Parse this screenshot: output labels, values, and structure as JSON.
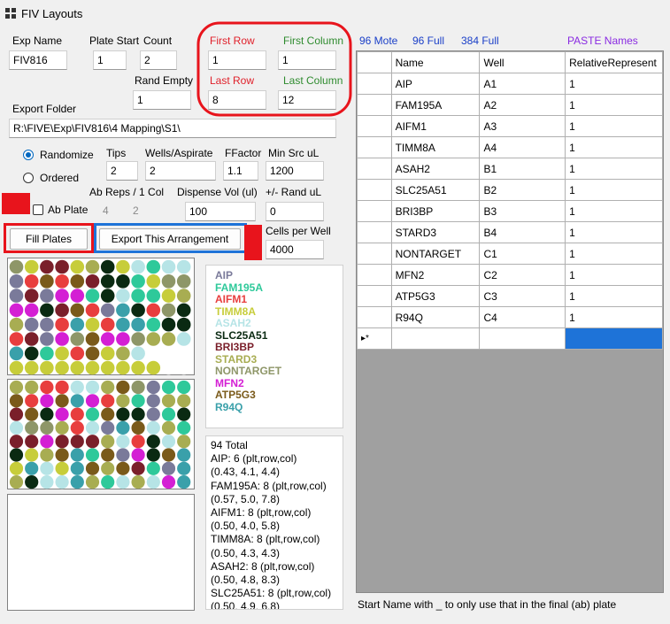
{
  "window": {
    "title": "FIV Layouts"
  },
  "form": {
    "exp_name": {
      "label": "Exp Name",
      "value": "FIV816"
    },
    "plate_start": {
      "label": "Plate Start",
      "value": "1"
    },
    "count": {
      "label": "Count",
      "value": "2"
    },
    "rand_empty": {
      "label": "Rand Empty",
      "value": "1"
    },
    "first_row": {
      "label": "First Row",
      "value": "1"
    },
    "first_column": {
      "label": "First Column",
      "value": "1"
    },
    "last_row": {
      "label": "Last Row",
      "value": "8"
    },
    "last_column": {
      "label": "Last Column",
      "value": "12"
    },
    "export_folder": {
      "label": "Export Folder",
      "value": "R:\\FIVE\\Exp\\FIV816\\4 Mapping\\S1\\"
    },
    "randomize_label": "Randomize",
    "ordered_label": "Ordered",
    "tips": {
      "label": "Tips",
      "value": "2"
    },
    "wells_aspirate": {
      "label": "Wells/Aspirate",
      "value": "2"
    },
    "ffactor": {
      "label": "FFactor",
      "value": "1.1"
    },
    "min_src_ul": {
      "label": "Min Src uL",
      "value": "1200"
    },
    "ab_reps_label": "Ab Reps / 1 Col",
    "ab_reps_a": "4",
    "ab_reps_b": "2",
    "dispense_vol": {
      "label": "Dispense Vol (ul)",
      "value": "100"
    },
    "rand_ul": {
      "label": "+/- Rand uL",
      "value": "0"
    },
    "ab_plate_label": "Ab Plate",
    "cells_per_well": {
      "label": "Cells per Well",
      "value": "4000"
    },
    "fill_plates_label": "Fill Plates",
    "export_label": "Export This Arrangement"
  },
  "links": {
    "mote96": "96 Mote",
    "full96": "96 Full",
    "full384": "384 Full",
    "paste_names": "PASTE Names"
  },
  "colors": {
    "accent_red": "#e8141c",
    "accent_blue": "#1e73d8",
    "link_blue": "#1a3fc8",
    "paste_purple": "#8a2be2",
    "first_row_red": "#e0202a",
    "first_col_green": "#2e8b2e"
  },
  "legend": [
    {
      "name": "AIP",
      "color": "#7a7a9a"
    },
    {
      "name": "FAM195A",
      "color": "#2ec99a"
    },
    {
      "name": "AIFM1",
      "color": "#e83e3e"
    },
    {
      "name": "TIMM8A",
      "color": "#c7cd3a"
    },
    {
      "name": "ASAH2",
      "color": "#b6e4e6"
    },
    {
      "name": "SLC25A51",
      "color": "#0a2a12"
    },
    {
      "name": "BRI3BP",
      "color": "#7a1f2a"
    },
    {
      "name": "STARD3",
      "color": "#a8ad52"
    },
    {
      "name": "NONTARGET",
      "color": "#8e9668"
    },
    {
      "name": "MFN2",
      "color": "#d41fd4"
    },
    {
      "name": "ATP5G3",
      "color": "#7a5a1a"
    },
    {
      "name": "R94Q",
      "color": "#3aa0aa"
    }
  ],
  "plate1": [
    [
      "NONTARGET",
      "TIMM8A",
      "BRI3BP",
      "BRI3BP",
      "TIMM8A",
      "STARD3",
      "SLC25A51",
      "TIMM8A",
      "ASAH2",
      "FAM195A",
      "ASAH2",
      "ASAH2"
    ],
    [
      "AIP",
      "AIFM1",
      "ATP5G3",
      "AIFM1",
      "ATP5G3",
      "BRI3BP",
      "SLC25A51",
      "SLC25A51",
      "FAM195A",
      "TIMM8A",
      "NONTARGET",
      "NONTARGET"
    ],
    [
      "AIP",
      "BRI3BP",
      "AIP",
      "MFN2",
      "MFN2",
      "FAM195A",
      "SLC25A51",
      "ASAH2",
      "FAM195A",
      "FAM195A",
      "TIMM8A",
      "STARD3"
    ],
    [
      "MFN2",
      "MFN2",
      "SLC25A51",
      "BRI3BP",
      "ATP5G3",
      "AIFM1",
      "AIP",
      "R94Q",
      "SLC25A51",
      "AIFM1",
      "NONTARGET",
      "SLC25A51"
    ],
    [
      "STARD3",
      "AIP",
      "AIP",
      "AIFM1",
      "R94Q",
      "TIMM8A",
      "AIFM1",
      "R94Q",
      "R94Q",
      "FAM195A",
      "SLC25A51",
      "SLC25A51"
    ],
    [
      "AIFM1",
      "BRI3BP",
      "AIP",
      "MFN2",
      "NONTARGET",
      "ATP5G3",
      "MFN2",
      "MFN2",
      "NONTARGET",
      "STARD3",
      "STARD3",
      "ASAH2"
    ],
    [
      "R94Q",
      "SLC25A51",
      "FAM195A",
      "TIMM8A",
      "AIFM1",
      "ATP5G3",
      "TIMM8A",
      "STARD3",
      "ASAH2",
      "",
      "",
      ""
    ],
    [
      "TIMM8A",
      "TIMM8A",
      "TIMM8A",
      "TIMM8A",
      "TIMM8A",
      "TIMM8A",
      "TIMM8A",
      "TIMM8A",
      "TIMM8A",
      "TIMM8A",
      "",
      ""
    ]
  ],
  "plate2": [
    [
      "STARD3",
      "STARD3",
      "AIFM1",
      "AIFM1",
      "ASAH2",
      "ASAH2",
      "STARD3",
      "ATP5G3",
      "NONTARGET",
      "AIP",
      "FAM195A",
      "FAM195A"
    ],
    [
      "ATP5G3",
      "AIFM1",
      "MFN2",
      "ATP5G3",
      "R94Q",
      "MFN2",
      "AIFM1",
      "STARD3",
      "FAM195A",
      "AIP",
      "STARD3",
      "STARD3"
    ],
    [
      "BRI3BP",
      "ATP5G3",
      "SLC25A51",
      "MFN2",
      "AIFM1",
      "FAM195A",
      "ATP5G3",
      "SLC25A51",
      "SLC25A51",
      "AIP",
      "FAM195A",
      "SLC25A51"
    ],
    [
      "ASAH2",
      "NONTARGET",
      "NONTARGET",
      "STARD3",
      "AIFM1",
      "ASAH2",
      "AIP",
      "R94Q",
      "ATP5G3",
      "ASAH2",
      "STARD3",
      "FAM195A"
    ],
    [
      "BRI3BP",
      "BRI3BP",
      "MFN2",
      "BRI3BP",
      "BRI3BP",
      "BRI3BP",
      "STARD3",
      "ASAH2",
      "AIFM1",
      "SLC25A51",
      "ASAH2",
      "STARD3"
    ],
    [
      "SLC25A51",
      "TIMM8A",
      "STARD3",
      "ATP5G3",
      "R94Q",
      "FAM195A",
      "ATP5G3",
      "AIP",
      "MFN2",
      "SLC25A51",
      "ATP5G3",
      "R94Q"
    ],
    [
      "TIMM8A",
      "R94Q",
      "ASAH2",
      "TIMM8A",
      "R94Q",
      "ATP5G3",
      "STARD3",
      "ATP5G3",
      "BRI3BP",
      "FAM195A",
      "AIP",
      "R94Q"
    ],
    [
      "STARD3",
      "SLC25A51",
      "ASAH2",
      "ASAH2",
      "R94Q",
      "STARD3",
      "FAM195A",
      "ASAH2",
      "STARD3",
      "ASAH2",
      "MFN2",
      "R94Q"
    ]
  ],
  "summary": [
    "94 Total",
    "AIP: 6  (plt,row,col)",
    " (0.43, 4.1, 4.4)",
    "FAM195A: 8  (plt,row,col)",
    " (0.57, 5.0, 7.8)",
    "AIFM1: 8  (plt,row,col)",
    " (0.50, 4.0, 5.8)",
    "TIMM8A: 8  (plt,row,col)",
    " (0.50, 4.3, 4.3)",
    "ASAH2: 8  (plt,row,col)",
    " (0.50, 4.8, 8.3)",
    "SLC25A51: 8  (plt,row,col)",
    " (0.50, 4.9, 6.8)"
  ],
  "grid": {
    "columns": [
      "Name",
      "Well",
      "RelativeRepresent"
    ],
    "rows": [
      [
        "AIP",
        "A1",
        "1"
      ],
      [
        "FAM195A",
        "A2",
        "1"
      ],
      [
        "AIFM1",
        "A3",
        "1"
      ],
      [
        "TIMM8A",
        "A4",
        "1"
      ],
      [
        "ASAH2",
        "B1",
        "1"
      ],
      [
        "SLC25A51",
        "B2",
        "1"
      ],
      [
        "BRI3BP",
        "B3",
        "1"
      ],
      [
        "STARD3",
        "B4",
        "1"
      ],
      [
        "NONTARGET",
        "C1",
        "1"
      ],
      [
        "MFN2",
        "C2",
        "1"
      ],
      [
        "ATP5G3",
        "C3",
        "1"
      ],
      [
        "R94Q",
        "C4",
        "1"
      ]
    ],
    "new_row_marker": "▸*"
  },
  "status_text": "Start Name with _ to only use that in the final (ab) plate"
}
